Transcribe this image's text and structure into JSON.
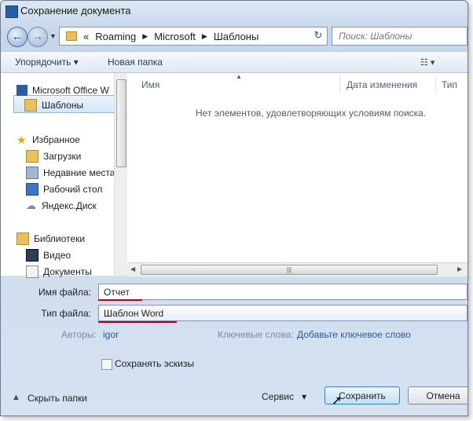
{
  "window": {
    "title": "Сохранение документа"
  },
  "address": {
    "prefix": "«",
    "crumbs": [
      "Roaming",
      "Microsoft",
      "Шаблоны"
    ]
  },
  "search": {
    "placeholder": "Поиск: Шаблоны"
  },
  "toolbar": {
    "organize": "Упорядочить",
    "new_folder": "Новая папка"
  },
  "nav": {
    "items": [
      {
        "label": "Microsoft Office W",
        "icon": "word-icon"
      },
      {
        "label": "Шаблоны",
        "icon": "folder-icon",
        "selected": true
      },
      {
        "label": "Избранное",
        "icon": "star-icon"
      },
      {
        "label": "Загрузки",
        "icon": "downloads-folder-icon"
      },
      {
        "label": "Недавние места",
        "icon": "recent-places-icon"
      },
      {
        "label": "Рабочий стол",
        "icon": "desktop-icon"
      },
      {
        "label": "Яндекс.Диск",
        "icon": "yandex-disk-icon"
      },
      {
        "label": "Библиотеки",
        "icon": "libraries-icon"
      },
      {
        "label": "Видео",
        "icon": "video-icon"
      },
      {
        "label": "Документы",
        "icon": "documents-icon"
      }
    ]
  },
  "columns": {
    "name": "Имя",
    "modified": "Дата изменения",
    "type": "Тип"
  },
  "empty_message": "Нет элементов, удовлетворяющих условиям поиска.",
  "form": {
    "filename_label": "Имя файла:",
    "filename_value": "Отчет",
    "filetype_label": "Тип файла:",
    "filetype_value": "Шаблон Word",
    "authors_label": "Авторы:",
    "authors_value": "igor",
    "keywords_label": "Ключевые слова:",
    "keywords_value": "Добавьте ключевое слово",
    "thumbnails_label": "Сохранять эскизы"
  },
  "footer": {
    "hide_folders": "Скрыть папки",
    "service": "Сервис",
    "save": "Сохранить",
    "cancel": "Отмена"
  },
  "colors": {
    "accent": "#2a5aa0",
    "selection": "#d3e7fb",
    "annotation": "#b60015"
  }
}
